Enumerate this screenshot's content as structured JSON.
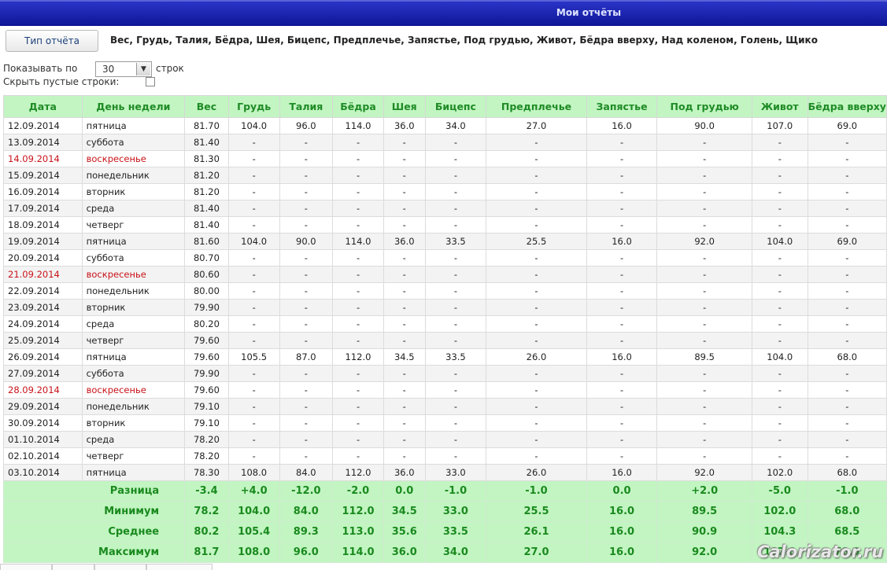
{
  "window": {
    "title": "Мои отчёты"
  },
  "toolbar": {
    "report_type_button": "Тип отчёта",
    "measures": "Вес, Грудь, Талия, Бёдра, Шея, Бицепс, Предплечье, Запястье, Под грудью, Живот, Бёдра вверху, Над коленом, Голень, Щико"
  },
  "paging": {
    "show_label": "Показывать по",
    "show_value": "30",
    "rows_label": "строк"
  },
  "hide_empty": {
    "label": "Скрыть пустые строки:",
    "checked": false
  },
  "table": {
    "columns": [
      "Дата",
      "День недели",
      "Вес",
      "Грудь",
      "Талия",
      "Бёдра",
      "Шея",
      "Бицепс",
      "Предплечье",
      "Запястье",
      "Под грудью",
      "Живот",
      "Бёдра вверху"
    ],
    "rows": [
      {
        "date": "12.09.2014",
        "day": "пятница",
        "sunday": false,
        "values": [
          "81.70",
          "104.0",
          "96.0",
          "114.0",
          "36.0",
          "34.0",
          "27.0",
          "16.0",
          "90.0",
          "107.0",
          "69.0"
        ]
      },
      {
        "date": "13.09.2014",
        "day": "суббота",
        "sunday": false,
        "values": [
          "81.40",
          "-",
          "-",
          "-",
          "-",
          "-",
          "-",
          "-",
          "-",
          "-",
          "-"
        ]
      },
      {
        "date": "14.09.2014",
        "day": "воскресенье",
        "sunday": true,
        "values": [
          "81.30",
          "-",
          "-",
          "-",
          "-",
          "-",
          "-",
          "-",
          "-",
          "-",
          "-"
        ]
      },
      {
        "date": "15.09.2014",
        "day": "понедельник",
        "sunday": false,
        "values": [
          "81.20",
          "-",
          "-",
          "-",
          "-",
          "-",
          "-",
          "-",
          "-",
          "-",
          "-"
        ]
      },
      {
        "date": "16.09.2014",
        "day": "вторник",
        "sunday": false,
        "values": [
          "81.20",
          "-",
          "-",
          "-",
          "-",
          "-",
          "-",
          "-",
          "-",
          "-",
          "-"
        ]
      },
      {
        "date": "17.09.2014",
        "day": "среда",
        "sunday": false,
        "values": [
          "81.40",
          "-",
          "-",
          "-",
          "-",
          "-",
          "-",
          "-",
          "-",
          "-",
          "-"
        ]
      },
      {
        "date": "18.09.2014",
        "day": "четверг",
        "sunday": false,
        "values": [
          "81.40",
          "-",
          "-",
          "-",
          "-",
          "-",
          "-",
          "-",
          "-",
          "-",
          "-"
        ]
      },
      {
        "date": "19.09.2014",
        "day": "пятница",
        "sunday": false,
        "values": [
          "81.60",
          "104.0",
          "90.0",
          "114.0",
          "36.0",
          "33.5",
          "25.5",
          "16.0",
          "92.0",
          "104.0",
          "69.0"
        ]
      },
      {
        "date": "20.09.2014",
        "day": "суббота",
        "sunday": false,
        "values": [
          "80.70",
          "-",
          "-",
          "-",
          "-",
          "-",
          "-",
          "-",
          "-",
          "-",
          "-"
        ]
      },
      {
        "date": "21.09.2014",
        "day": "воскресенье",
        "sunday": true,
        "values": [
          "80.60",
          "-",
          "-",
          "-",
          "-",
          "-",
          "-",
          "-",
          "-",
          "-",
          "-"
        ]
      },
      {
        "date": "22.09.2014",
        "day": "понедельник",
        "sunday": false,
        "values": [
          "80.00",
          "-",
          "-",
          "-",
          "-",
          "-",
          "-",
          "-",
          "-",
          "-",
          "-"
        ]
      },
      {
        "date": "23.09.2014",
        "day": "вторник",
        "sunday": false,
        "values": [
          "79.90",
          "-",
          "-",
          "-",
          "-",
          "-",
          "-",
          "-",
          "-",
          "-",
          "-"
        ]
      },
      {
        "date": "24.09.2014",
        "day": "среда",
        "sunday": false,
        "values": [
          "80.20",
          "-",
          "-",
          "-",
          "-",
          "-",
          "-",
          "-",
          "-",
          "-",
          "-"
        ]
      },
      {
        "date": "25.09.2014",
        "day": "четверг",
        "sunday": false,
        "values": [
          "79.60",
          "-",
          "-",
          "-",
          "-",
          "-",
          "-",
          "-",
          "-",
          "-",
          "-"
        ]
      },
      {
        "date": "26.09.2014",
        "day": "пятница",
        "sunday": false,
        "values": [
          "79.60",
          "105.5",
          "87.0",
          "112.0",
          "34.5",
          "33.5",
          "26.0",
          "16.0",
          "89.5",
          "104.0",
          "68.0"
        ]
      },
      {
        "date": "27.09.2014",
        "day": "суббота",
        "sunday": false,
        "values": [
          "79.90",
          "-",
          "-",
          "-",
          "-",
          "-",
          "-",
          "-",
          "-",
          "-",
          "-"
        ]
      },
      {
        "date": "28.09.2014",
        "day": "воскресенье",
        "sunday": true,
        "values": [
          "79.60",
          "-",
          "-",
          "-",
          "-",
          "-",
          "-",
          "-",
          "-",
          "-",
          "-"
        ]
      },
      {
        "date": "29.09.2014",
        "day": "понедельник",
        "sunday": false,
        "values": [
          "79.10",
          "-",
          "-",
          "-",
          "-",
          "-",
          "-",
          "-",
          "-",
          "-",
          "-"
        ]
      },
      {
        "date": "30.09.2014",
        "day": "вторник",
        "sunday": false,
        "values": [
          "79.10",
          "-",
          "-",
          "-",
          "-",
          "-",
          "-",
          "-",
          "-",
          "-",
          "-"
        ]
      },
      {
        "date": "01.10.2014",
        "day": "среда",
        "sunday": false,
        "values": [
          "78.20",
          "-",
          "-",
          "-",
          "-",
          "-",
          "-",
          "-",
          "-",
          "-",
          "-"
        ]
      },
      {
        "date": "02.10.2014",
        "day": "четверг",
        "sunday": false,
        "values": [
          "78.20",
          "-",
          "-",
          "-",
          "-",
          "-",
          "-",
          "-",
          "-",
          "-",
          "-"
        ]
      },
      {
        "date": "03.10.2014",
        "day": "пятница",
        "sunday": false,
        "values": [
          "78.30",
          "108.0",
          "84.0",
          "112.0",
          "36.0",
          "33.0",
          "26.0",
          "16.0",
          "92.0",
          "102.0",
          "68.0"
        ]
      }
    ],
    "summary": [
      {
        "label": "Разница",
        "values": [
          "-3.4",
          "+4.0",
          "-12.0",
          "-2.0",
          "0.0",
          "-1.0",
          "-1.0",
          "0.0",
          "+2.0",
          "-5.0",
          "-1.0"
        ]
      },
      {
        "label": "Минимум",
        "values": [
          "78.2",
          "104.0",
          "84.0",
          "112.0",
          "34.5",
          "33.0",
          "25.5",
          "16.0",
          "89.5",
          "102.0",
          "68.0"
        ]
      },
      {
        "label": "Среднее",
        "values": [
          "80.2",
          "105.4",
          "89.3",
          "113.0",
          "35.6",
          "33.5",
          "26.1",
          "16.0",
          "90.9",
          "104.3",
          "68.5"
        ]
      },
      {
        "label": "Максимум",
        "values": [
          "81.7",
          "108.0",
          "96.0",
          "114.0",
          "36.0",
          "34.0",
          "27.0",
          "16.0",
          "92.0",
          "107.0",
          "70.0"
        ]
      }
    ]
  },
  "watermark": "Calorizator.ru",
  "colors": {
    "title_bar": "#1a22b0",
    "header_green": "#c2f5c2",
    "header_text": "#1f8b25",
    "sunday_red": "#c8141a"
  }
}
